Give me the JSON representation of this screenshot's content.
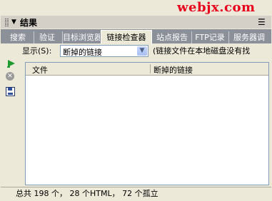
{
  "watermark": "webjx.com",
  "panel": {
    "title": "结果"
  },
  "tabs": [
    {
      "label": "搜索"
    },
    {
      "label": "验证"
    },
    {
      "label": "目标浏览器"
    },
    {
      "label": "链接检查器"
    },
    {
      "label": "站点报告"
    },
    {
      "label": "FTP记录"
    },
    {
      "label": "服务器调"
    }
  ],
  "toolbar": {
    "show_label": "显示(S):",
    "show_value": "断掉的链接",
    "hint": "(链接文件在本地磁盘没有找"
  },
  "table": {
    "columns": [
      "文件",
      "断掉的链接"
    ]
  },
  "status": {
    "text": "总共 198 个， 28 个HTML， 72 个孤立"
  },
  "icons": [
    "play-icon",
    "stop-icon",
    "save-icon",
    "chevron-down-icon",
    "menu-icon",
    "collapse-triangle-icon"
  ]
}
